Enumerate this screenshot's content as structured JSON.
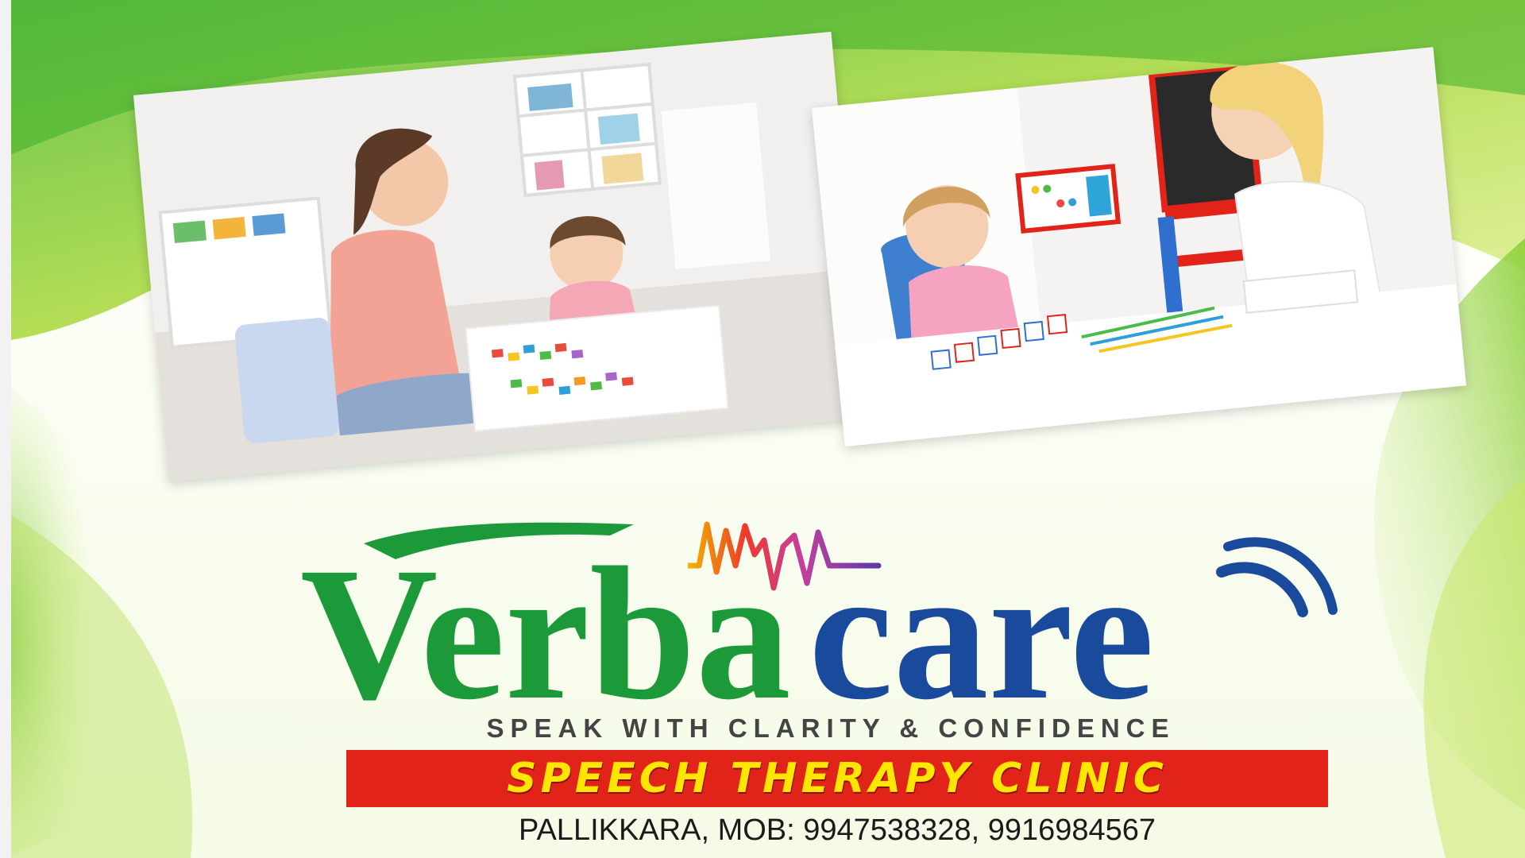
{
  "brand": {
    "part1": "Verba",
    "part2": "care",
    "color_green": "#1c9a3a",
    "color_blue": "#1a4a9c"
  },
  "tagline": "SPEAK WITH CLARITY & CONFIDENCE",
  "banner": {
    "text": "SPEECH THERAPY CLINIC",
    "background": "#e2231a",
    "text_color": "#ffe600"
  },
  "contact": "PALLIKKARA, MOB: 9947538328, 9916984567",
  "photos": [
    {
      "icon": "therapist-with-child-photo"
    },
    {
      "icon": "child-speech-practice-photo"
    }
  ]
}
